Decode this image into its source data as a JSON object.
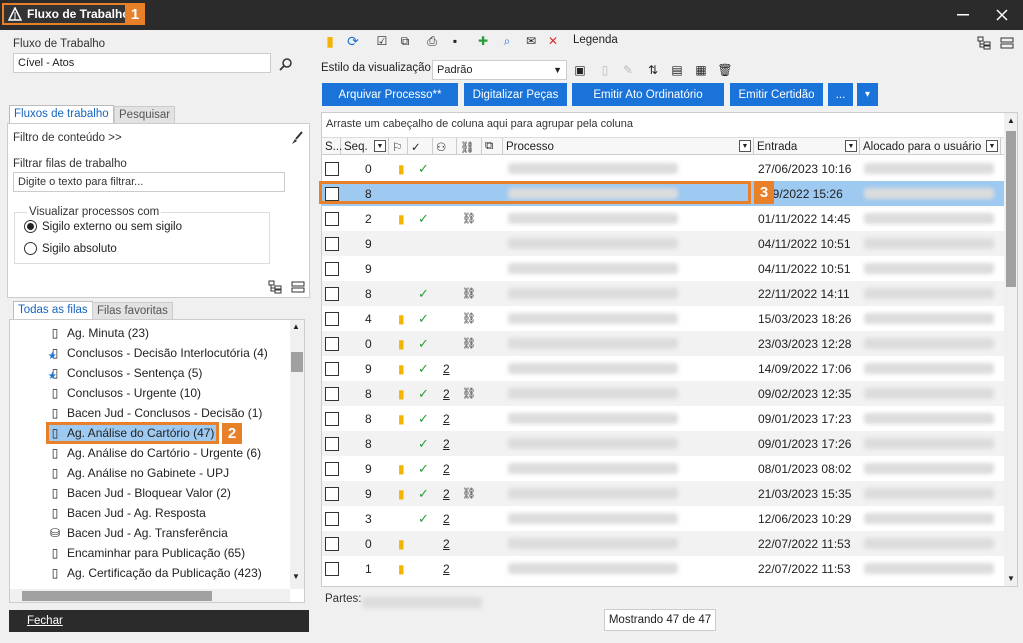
{
  "window": {
    "title": "Fluxo de Trabalho",
    "badge": "1"
  },
  "left": {
    "workflow_label": "Fluxo de Trabalho",
    "workflow_value": "Cível - Atos",
    "tabs": [
      "Fluxos de trabalho",
      "Pesquisar"
    ],
    "content_filter": "Filtro de conteúdo >>",
    "filter_queues_label": "Filtrar filas de trabalho",
    "filter_placeholder": "Digite o texto para filtrar...",
    "visualize_label": "Visualizar processos com",
    "radio_options": [
      "Sigilo externo ou sem sigilo",
      "Sigilo absoluto"
    ],
    "queue_tabs": [
      "Todas as filas",
      "Filas favoritas"
    ],
    "tree": [
      {
        "label": "Ag. Minuta (23)",
        "icon": "doc-icon"
      },
      {
        "label": "Conclusos - Decisão Interlocutória (4)",
        "icon": "star-doc-icon"
      },
      {
        "label": "Conclusos - Sentença (5)",
        "icon": "star-doc-icon"
      },
      {
        "label": "Conclusos - Urgente (10)",
        "icon": "doc-icon"
      },
      {
        "label": "Bacen Jud - Conclusos - Decisão (1)",
        "icon": "doc-icon"
      },
      {
        "label": "Ag. Análise do Cartório (47)",
        "icon": "doc-icon"
      },
      {
        "label": "Ag. Análise do Cartório - Urgente (6)",
        "icon": "doc-icon"
      },
      {
        "label": "Ag. Análise no Gabinete - UPJ",
        "icon": "doc-icon"
      },
      {
        "label": "Bacen Jud - Bloquear Valor (2)",
        "icon": "doc-icon"
      },
      {
        "label": "Bacen Jud - Ag. Resposta",
        "icon": "doc-icon"
      },
      {
        "label": "Bacen Jud - Ag. Transferência",
        "icon": "transfer-icon"
      },
      {
        "label": "Encaminhar para Publicação (65)",
        "icon": "doc-icon"
      },
      {
        "label": "Ag. Certificação da Publicação (423)",
        "icon": "doc-icon"
      }
    ],
    "selected_badge": "2",
    "close_button": "Fechar"
  },
  "right": {
    "legend": "Legenda",
    "style_label": "Estilo da visualização",
    "style_value": "Padrão",
    "buttons": [
      "Arquivar Processo**",
      "Digitalizar Peças",
      "Emitir Ato Ordinatório",
      "Emitir Certidão",
      "..."
    ],
    "group_hint": "Arraste um cabeçalho de coluna aqui para agrupar pela coluna",
    "headers": {
      "s": "S...",
      "seq": "Seq.",
      "processo": "Processo",
      "entrada": "Entrada",
      "alocado": "Alocado para o usuário"
    },
    "rows": [
      {
        "seq": "0",
        "flag": true,
        "check": true,
        "count": "",
        "link": false,
        "date": "27/06/2023 10:16"
      },
      {
        "seq": "8",
        "flag": false,
        "check": false,
        "count": "",
        "link": false,
        "date": "09/2022 15:26"
      },
      {
        "seq": "2",
        "flag": true,
        "check": true,
        "count": "",
        "link": true,
        "date": "01/11/2022 14:45"
      },
      {
        "seq": "9",
        "flag": false,
        "check": false,
        "count": "",
        "link": false,
        "date": "04/11/2022 10:51"
      },
      {
        "seq": "9",
        "flag": false,
        "check": false,
        "count": "",
        "link": false,
        "date": "04/11/2022 10:51"
      },
      {
        "seq": "8",
        "flag": false,
        "check": true,
        "count": "",
        "link": true,
        "date": "22/11/2022 14:11"
      },
      {
        "seq": "4",
        "flag": true,
        "check": true,
        "count": "",
        "link": true,
        "date": "15/03/2023 18:26"
      },
      {
        "seq": "0",
        "flag": true,
        "check": true,
        "count": "",
        "link": true,
        "date": "23/03/2023 12:28"
      },
      {
        "seq": "9",
        "flag": true,
        "check": true,
        "count": "2",
        "link": false,
        "date": "14/09/2022 17:06"
      },
      {
        "seq": "8",
        "flag": true,
        "check": true,
        "count": "2",
        "link": true,
        "date": "09/02/2023 12:35"
      },
      {
        "seq": "8",
        "flag": true,
        "check": true,
        "count": "2",
        "link": false,
        "date": "09/01/2023 17:23"
      },
      {
        "seq": "8",
        "flag": false,
        "check": true,
        "count": "2",
        "link": false,
        "date": "09/01/2023 17:26"
      },
      {
        "seq": "9",
        "flag": true,
        "check": true,
        "count": "2",
        "link": false,
        "date": "08/01/2023 08:02"
      },
      {
        "seq": "9",
        "flag": true,
        "check": true,
        "count": "2",
        "link": true,
        "date": "21/03/2023 15:35"
      },
      {
        "seq": "3",
        "flag": false,
        "check": true,
        "count": "2",
        "link": false,
        "date": "12/06/2023 10:29"
      },
      {
        "seq": "0",
        "flag": true,
        "check": false,
        "count": "2",
        "link": false,
        "date": "22/07/2022 11:53"
      },
      {
        "seq": "1",
        "flag": true,
        "check": false,
        "count": "2",
        "link": false,
        "date": "22/07/2022 11:53"
      }
    ],
    "selected_badge": "3",
    "partes_label": "Partes:",
    "status": "Mostrando 47 de 47"
  },
  "colors": {
    "accent": "#e8802a",
    "button_blue": "#1a73d9",
    "selection": "#9ec9f0"
  }
}
